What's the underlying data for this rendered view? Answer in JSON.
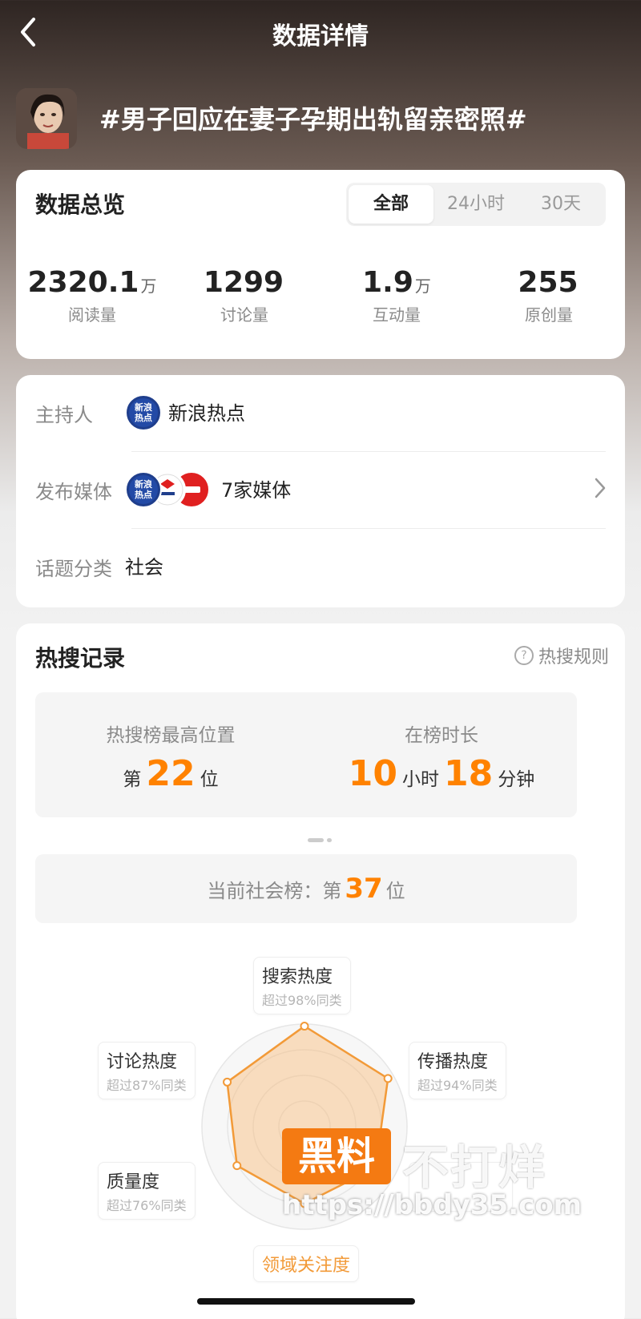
{
  "nav": {
    "title": "数据详情"
  },
  "topic": {
    "title": "#男子回应在妻子孕期出轨留亲密照#"
  },
  "overview": {
    "title": "数据总览",
    "tabs": [
      {
        "label": "全部",
        "active": true
      },
      {
        "label": "24小时",
        "active": false
      },
      {
        "label": "30天",
        "active": false
      }
    ],
    "stats": [
      {
        "value": "2320.1",
        "unit": "万",
        "label": "阅读量"
      },
      {
        "value": "1299",
        "unit": "",
        "label": "讨论量"
      },
      {
        "value": "1.9",
        "unit": "万",
        "label": "互动量"
      },
      {
        "value": "255",
        "unit": "",
        "label": "原创量"
      }
    ]
  },
  "info": {
    "host_label": "主持人",
    "host_name": "新浪热点",
    "host_logo_text": [
      "新浪",
      "热点"
    ],
    "media_label": "发布媒体",
    "media_count": "7家媒体",
    "category_label": "话题分类",
    "category_value": "社会"
  },
  "hot": {
    "title": "热搜记录",
    "rules_label": "热搜规则",
    "peak_caption": "热搜榜最高位置",
    "peak_prefix": "第",
    "peak_value": "22",
    "peak_suffix": "位",
    "duration_caption": "在榜时长",
    "duration_hours": "10",
    "duration_hours_unit": "小时",
    "duration_minutes": "18",
    "duration_minutes_unit": "分钟",
    "current_prefix": "当前社会榜：第",
    "current_value": "37",
    "current_suffix": "位"
  },
  "radar": {
    "axes": [
      {
        "name": "搜索热度",
        "sub": "超过98%同类",
        "score": 0.98
      },
      {
        "name": "传播热度",
        "sub": "超过94%同类",
        "score": 0.94
      },
      {
        "name": "",
        "sub": "",
        "score": 0.8
      },
      {
        "name": "领域关注度",
        "sub": "",
        "score": 0.75
      },
      {
        "name": "质量度",
        "sub": "超过76%同类",
        "score": 0.76
      },
      {
        "name": "讨论热度",
        "sub": "超过87%同类",
        "score": 0.87
      }
    ],
    "accent": "#f29a38"
  },
  "watermark": {
    "box_text": "黑料",
    "right_text": "不打烊",
    "url": "https://bbdy35.com"
  },
  "colors": {
    "accent": "#ff8200",
    "logo_blue": "#234aa6",
    "logo_red": "#e02020"
  }
}
